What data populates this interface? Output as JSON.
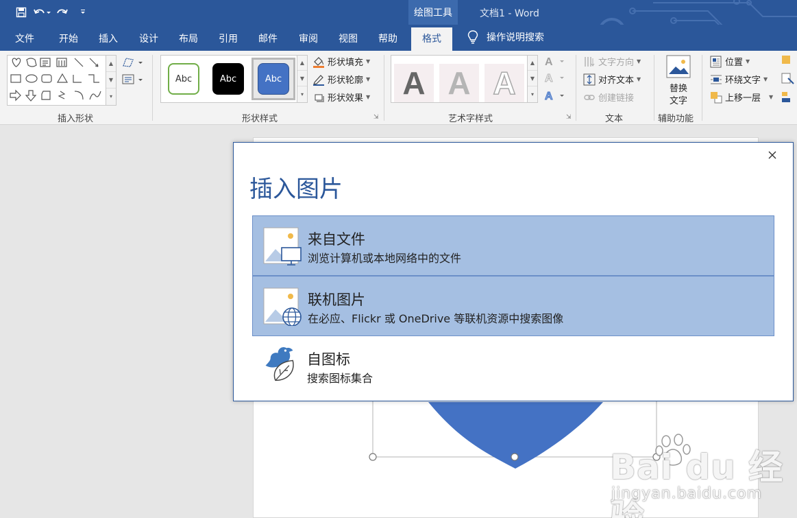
{
  "titlebar": {
    "context_tool": "绘图工具",
    "document_title": "文档1  -  Word",
    "qat": [
      "save-icon",
      "undo-icon",
      "redo-icon",
      "customize-icon"
    ]
  },
  "tabs": [
    {
      "label": "文件"
    },
    {
      "label": "开始"
    },
    {
      "label": "插入"
    },
    {
      "label": "设计"
    },
    {
      "label": "布局"
    },
    {
      "label": "引用"
    },
    {
      "label": "邮件"
    },
    {
      "label": "审阅"
    },
    {
      "label": "视图"
    },
    {
      "label": "帮助"
    },
    {
      "label": "格式",
      "active": true
    }
  ],
  "tell_me": "操作说明搜索",
  "ribbon": {
    "insert_shapes": {
      "label": "插入形状"
    },
    "shape_styles": {
      "label": "形状样式",
      "samples": [
        "Abc",
        "Abc",
        "Abc"
      ],
      "fill": "形状填充",
      "outline": "形状轮廓",
      "effects": "形状效果"
    },
    "wordart": {
      "label": "艺术字样式",
      "sample": "A"
    },
    "text": {
      "label": "文本",
      "direction": "文字方向",
      "align": "对齐文本",
      "link": "创建链接"
    },
    "accessibility": {
      "label": "辅助功能",
      "alt_text_line1": "替换",
      "alt_text_line2": "文字"
    },
    "arrange": {
      "position": "位置",
      "wrap": "环绕文字",
      "forward": "上移一层"
    }
  },
  "dialog": {
    "title": "插入图片",
    "options": [
      {
        "title": "来自文件",
        "desc": "浏览计算机或本地网络中的文件"
      },
      {
        "title": "联机图片",
        "desc": "在必应、Flickr 或 OneDrive 等联机资源中搜索图像"
      },
      {
        "title": "自图标",
        "desc": "搜索图标集合"
      }
    ]
  },
  "watermark": {
    "brand": "Bai du 经验",
    "url": "jingyan.baidu.com"
  },
  "colors": {
    "brand": "#2b579a",
    "selected_option": "#a5bfe2",
    "shape_fill": "#4472c4"
  }
}
